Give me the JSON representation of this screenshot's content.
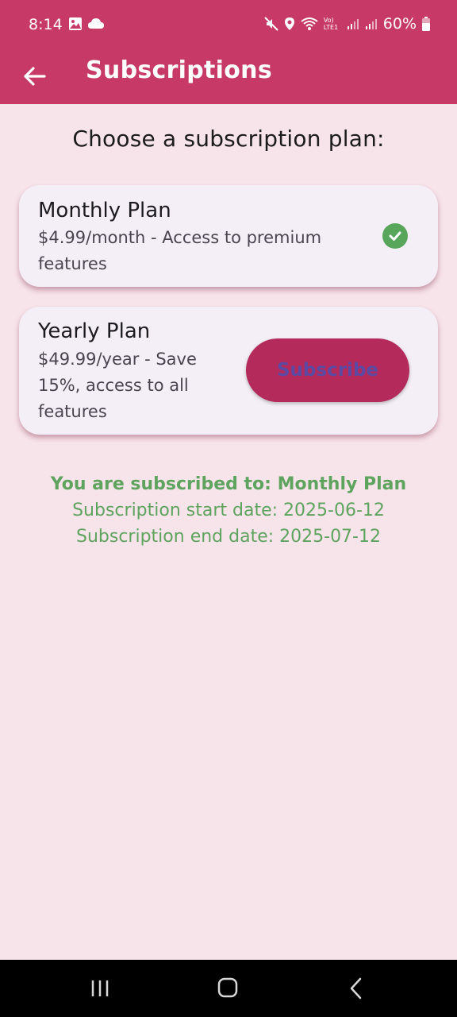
{
  "status_bar": {
    "time": "8:14",
    "battery": "60%",
    "network_label": "Vo) LTE1"
  },
  "app_bar": {
    "title": "Subscriptions"
  },
  "heading": "Choose a subscription plan:",
  "plans": [
    {
      "title": "Monthly Plan",
      "description": "$4.99/month - Access to premium features",
      "selected": true
    },
    {
      "title": "Yearly Plan",
      "description": "$49.99/year - Save 15%, access to all features",
      "button_label": "Subscribe"
    }
  ],
  "subscription_status": {
    "subscribed_to": "You are subscribed to: Monthly Plan",
    "start_date": "Subscription start date: 2025-06-12",
    "end_date": "Subscription end date: 2025-07-12"
  },
  "colors": {
    "primary": "#c73a67",
    "background": "#f7e4ea",
    "card": "#f4eff6",
    "button": "#b32a5b",
    "success": "#5ea45f"
  }
}
